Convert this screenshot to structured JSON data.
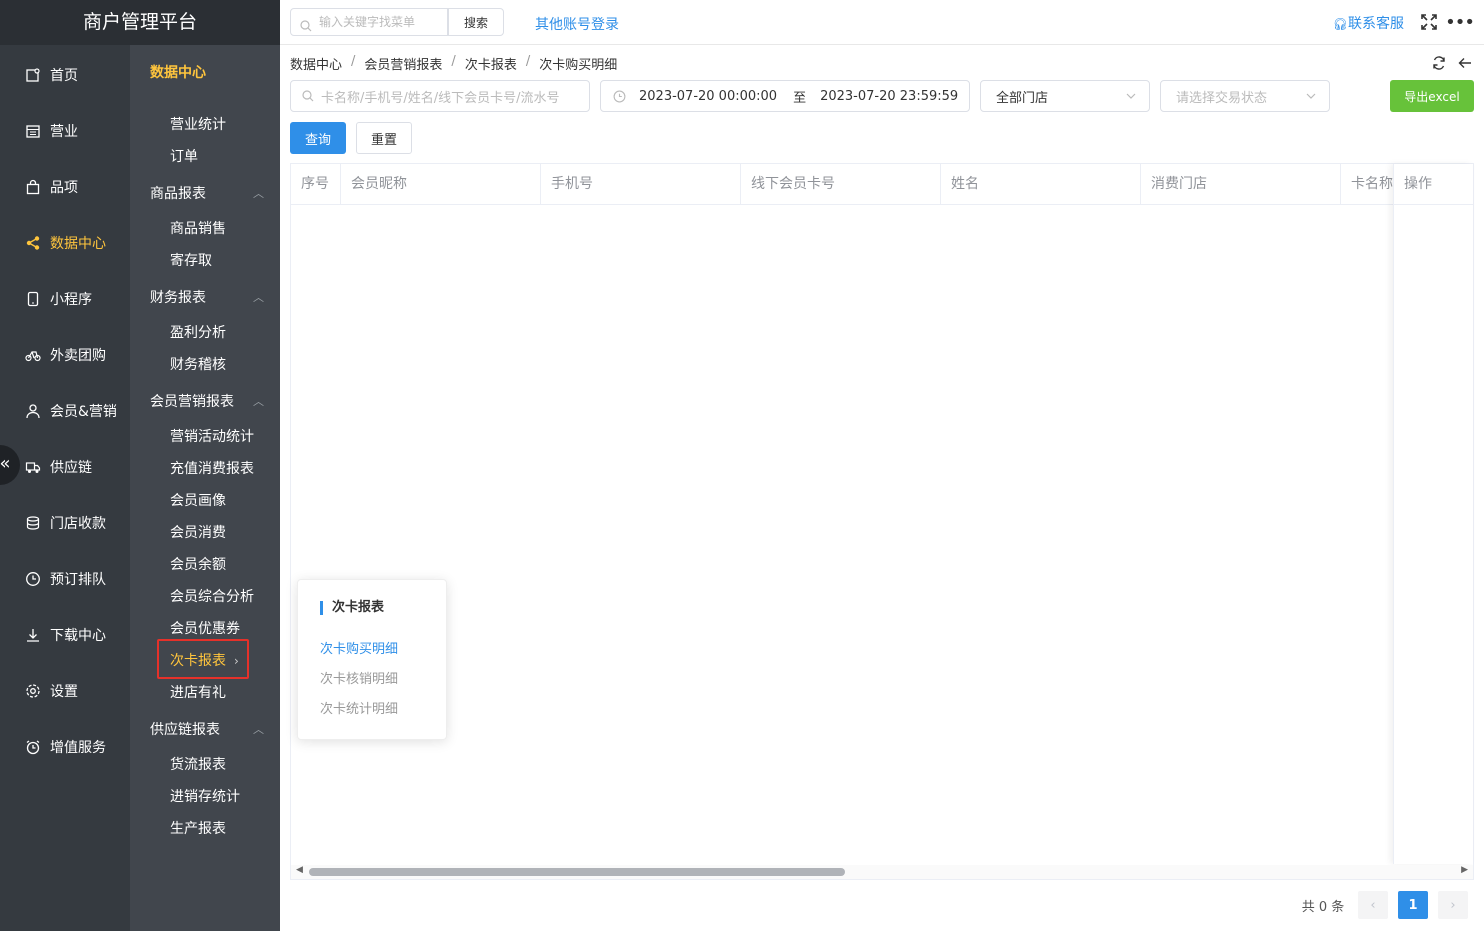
{
  "app": {
    "title": "商户管理平台"
  },
  "colors": {
    "accent": "#2f8fe8",
    "active_nav": "#ffc53d",
    "export_green": "#67c23a",
    "highlight_red": "#e5312a"
  },
  "nav1": [
    {
      "label": "首页",
      "icon": "home-icon"
    },
    {
      "label": "营业",
      "icon": "calendar-icon"
    },
    {
      "label": "品项",
      "icon": "bag-icon"
    },
    {
      "label": "数据中心",
      "icon": "share-icon",
      "active": true
    },
    {
      "label": "小程序",
      "icon": "phone-icon"
    },
    {
      "label": "外卖团购",
      "icon": "bike-icon"
    },
    {
      "label": "会员&营销",
      "icon": "user-icon"
    },
    {
      "label": "供应链",
      "icon": "truck-icon"
    },
    {
      "label": "门店收款",
      "icon": "coins-icon"
    },
    {
      "label": "预订排队",
      "icon": "clock-icon"
    },
    {
      "label": "下载中心",
      "icon": "download-icon"
    },
    {
      "label": "设置",
      "icon": "gear-icon"
    },
    {
      "label": "增值服务",
      "icon": "alarm-icon"
    }
  ],
  "nav2": {
    "header": "数据中心",
    "items": [
      "营业统计",
      "订单"
    ],
    "groups": [
      {
        "label": "商品报表",
        "items": [
          "商品销售",
          "寄存取"
        ]
      },
      {
        "label": "财务报表",
        "items": [
          "盈利分析",
          "财务稽核"
        ]
      },
      {
        "label": "会员营销报表",
        "items": [
          "营销活动统计",
          "充值消费报表",
          "会员画像",
          "会员消费",
          "会员余额",
          "会员综合分析",
          "会员优惠券",
          "次卡报表",
          "进店有礼"
        ]
      },
      {
        "label": "供应链报表",
        "items": [
          "货流报表",
          "进销存统计",
          "生产报表"
        ]
      }
    ]
  },
  "topbar": {
    "search_placeholder": "输入关键字找菜单",
    "search_btn": "搜索",
    "other_login": "其他账号登录",
    "service": "联系客服"
  },
  "breadcrumb": [
    "数据中心",
    "会员营销报表",
    "次卡报表",
    "次卡购买明细"
  ],
  "filters": {
    "keyword_placeholder": "卡名称/手机号/姓名/线下会员卡号/流水号",
    "date_start": "2023-07-20 00:00:00",
    "date_sep": "至",
    "date_end": "2023-07-20 23:59:59",
    "store": "全部门店",
    "status_placeholder": "请选择交易状态",
    "export": "导出excel",
    "query": "查询",
    "reset": "重置"
  },
  "table": {
    "columns": [
      "序号",
      "会员昵称",
      "手机号",
      "线下会员卡号",
      "姓名",
      "消费门店",
      "卡名称",
      "操作"
    ],
    "rows": []
  },
  "pagination": {
    "total": "共 0 条",
    "current": "1"
  },
  "popup": {
    "title": "次卡报表",
    "items": [
      "次卡购买明细",
      "次卡核销明细",
      "次卡统计明细"
    ],
    "active_index": 0
  }
}
